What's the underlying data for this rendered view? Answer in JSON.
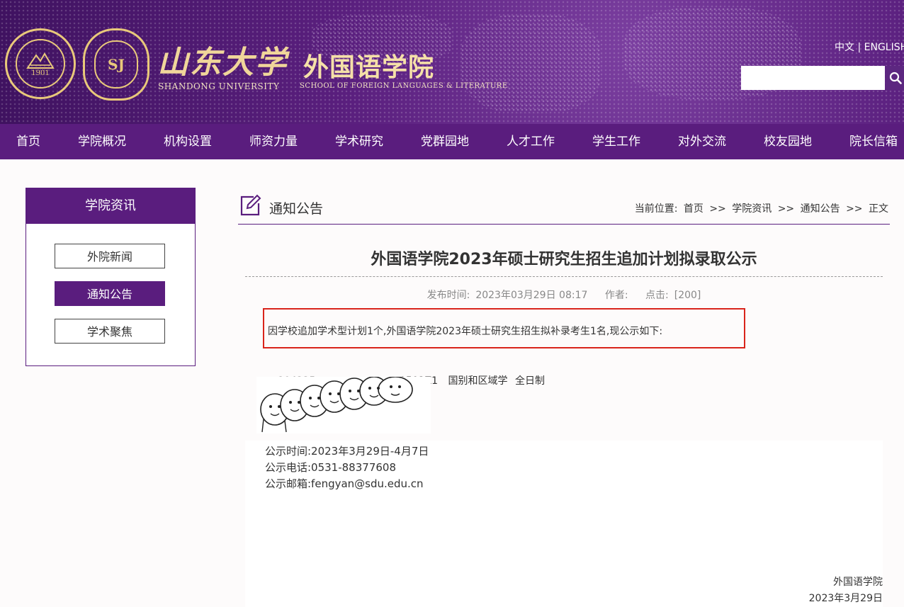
{
  "header": {
    "seal1_text": "1901",
    "seal1_ring": "SHANDONG UNIVERSITY",
    "seal2_text": "SJ",
    "logo_cn": "山东大学",
    "school_cn": "外国语学院",
    "logo_en": "SHANDONG UNIVERSITY",
    "school_en": "SCHOOL OF FOREIGN LANGUAGES & LITERATURE",
    "lang_cn": "中文",
    "lang_sep": "|",
    "lang_en": "ENGLISH",
    "search_value": "",
    "search_icon": "search-icon"
  },
  "nav": {
    "items": [
      "首页",
      "学院概况",
      "机构设置",
      "师资力量",
      "学术研究",
      "党群园地",
      "人才工作",
      "学生工作",
      "对外交流",
      "校友园地",
      "院长信箱"
    ]
  },
  "sidebar": {
    "title": "学院资讯",
    "items": [
      "外院新闻",
      "通知公告",
      "学术聚焦"
    ],
    "active_index": 1
  },
  "section": {
    "title": "通知公告",
    "icon": "edit-icon",
    "breadcrumb_label": "当前位置:",
    "breadcrumb": [
      "首页",
      ">>",
      "学院资讯",
      ">>",
      "通知公告",
      ">>",
      "正文"
    ]
  },
  "article": {
    "title": "外国语学院2023年硕士研究生招生追加计划拟录取公示",
    "meta_time_label": "发布时间:",
    "meta_time": "2023年03月29日 08:17",
    "meta_author_label": "作者:",
    "meta_clicks_label": "点击:",
    "meta_clicks": "[200]",
    "intro": "因学校追加学术型计划1个,外国语学院2023年硕士研究生招生拟补录考生1名,现公示如下:",
    "row_id_partial": "104225",
    "row_code": "0502Z1",
    "row_major": "国别和区域学",
    "row_mode": "全日制",
    "info_time": "公示时间:2023年3月29日-4月7日",
    "info_phone": "公示电话:0531-88377608",
    "info_email": "公示邮箱:fengyan@sdu.edu.cn",
    "sign_org": "外国语学院",
    "sign_date": "2023年3月29日"
  },
  "colors": {
    "brand_purple": "#5a1d7e",
    "gold": "#e9c97a",
    "highlight_red": "#d9241b"
  }
}
